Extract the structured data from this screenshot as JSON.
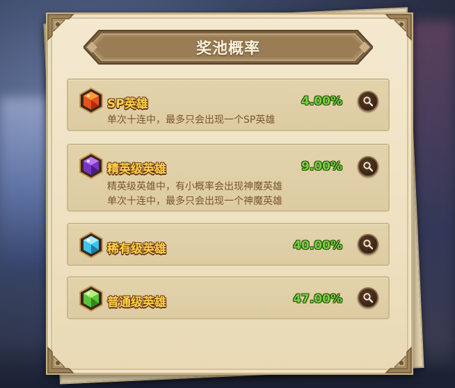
{
  "panel": {
    "title": "奖池概率"
  },
  "tiers": [
    {
      "name": "SP英雄",
      "percent": "4.00%",
      "gem_icon": "orange-hex-gem-icon",
      "gem_color": "#e5531c",
      "lines": [
        "单次十连中，最多只会出现一个SP英雄"
      ]
    },
    {
      "name": "精英级英雄",
      "percent": "9.00%",
      "gem_icon": "purple-hex-gem-icon",
      "gem_color": "#7a34c4",
      "lines": [
        "精英级英雄中，有小概率会出现神魔英雄",
        "单次十连中，最多只会出现一个神魔英雄"
      ]
    },
    {
      "name": "稀有级英雄",
      "percent": "40.00%",
      "gem_icon": "cyan-hex-gem-icon",
      "gem_color": "#3fc3e8"
    },
    {
      "name": "普通级英雄",
      "percent": "47.00%",
      "gem_icon": "green-hex-gem-icon",
      "gem_color": "#5cc43a"
    }
  ],
  "colors": {
    "tier_name": "#ffd24a",
    "percent": "#6fd436",
    "description": "#7a5530",
    "parchment": "#f3e9cf",
    "title_banner": "#8a6e4c"
  }
}
